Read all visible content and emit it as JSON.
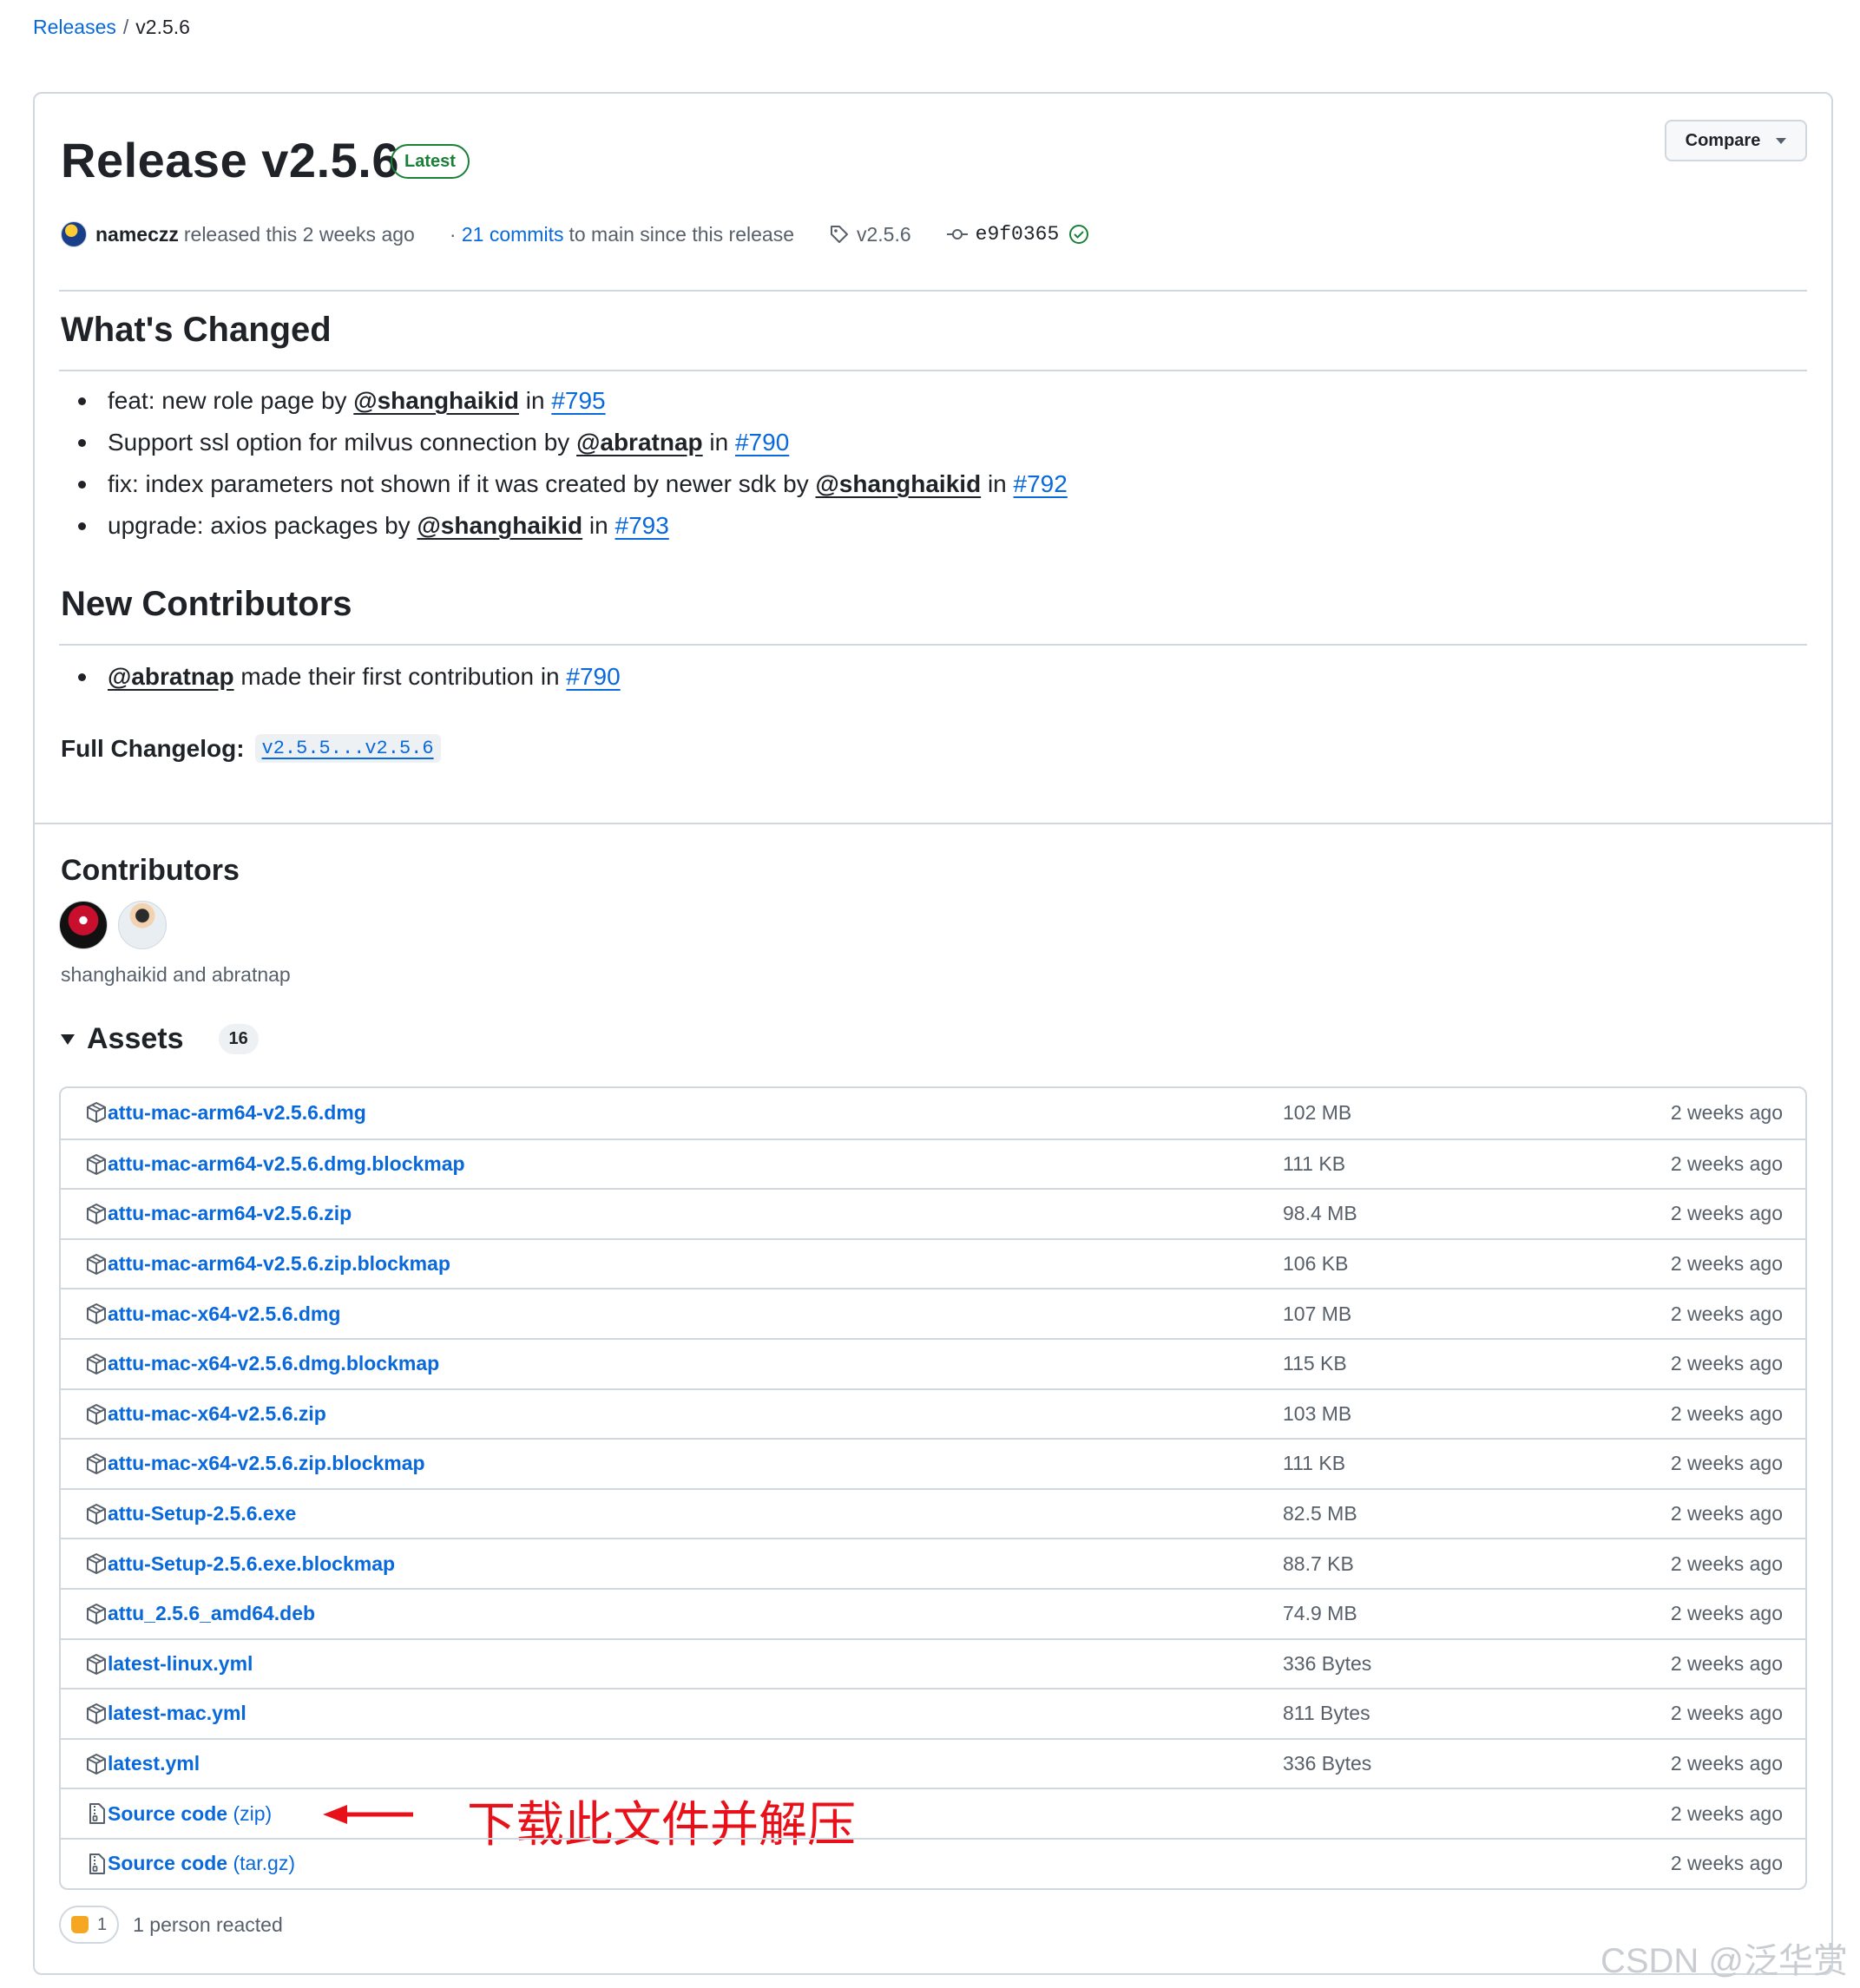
{
  "breadcrumb": {
    "releases": "Releases",
    "current": "v2.5.6"
  },
  "release": {
    "title": "Release v2.5.6",
    "badge": "Latest",
    "compare_label": "Compare",
    "author": "nameczz",
    "released_text": "released this 2 weeks ago",
    "commits_link": "21 commits",
    "commits_suffix": "to main since this release",
    "tag": "v2.5.6",
    "commit_sha": "e9f0365"
  },
  "whats_changed": {
    "title": "What's Changed",
    "items": [
      {
        "text": "feat: new role page by",
        "mention": "@shanghaikid",
        "in": "in",
        "issue": "#795"
      },
      {
        "text": "Support ssl option for milvus connection by",
        "mention": "@abratnap",
        "in": "in",
        "issue": "#790"
      },
      {
        "text": "fix: index parameters not shown if it was created by newer sdk by",
        "mention": "@shanghaikid",
        "in": "in",
        "issue": "#792"
      },
      {
        "text": "upgrade: axios packages by",
        "mention": "@shanghaikid",
        "in": "in",
        "issue": "#793"
      }
    ]
  },
  "new_contributors": {
    "title": "New Contributors",
    "items": [
      {
        "mention": "@abratnap",
        "text": "made their first contribution in",
        "issue": "#790"
      }
    ]
  },
  "changelog": {
    "label": "Full Changelog:",
    "range": "v2.5.5...v2.5.6"
  },
  "contributors": {
    "title": "Contributors",
    "names": "shanghaikid and abratnap"
  },
  "assets": {
    "title": "Assets",
    "count": "16",
    "rows": [
      {
        "name": "attu-mac-arm64-v2.5.6.dmg",
        "size": "102 MB",
        "date": "2 weeks ago",
        "icon": "package-icon"
      },
      {
        "name": "attu-mac-arm64-v2.5.6.dmg.blockmap",
        "size": "111 KB",
        "date": "2 weeks ago",
        "icon": "package-icon"
      },
      {
        "name": "attu-mac-arm64-v2.5.6.zip",
        "size": "98.4 MB",
        "date": "2 weeks ago",
        "icon": "package-icon"
      },
      {
        "name": "attu-mac-arm64-v2.5.6.zip.blockmap",
        "size": "106 KB",
        "date": "2 weeks ago",
        "icon": "package-icon"
      },
      {
        "name": "attu-mac-x64-v2.5.6.dmg",
        "size": "107 MB",
        "date": "2 weeks ago",
        "icon": "package-icon"
      },
      {
        "name": "attu-mac-x64-v2.5.6.dmg.blockmap",
        "size": "115 KB",
        "date": "2 weeks ago",
        "icon": "package-icon"
      },
      {
        "name": "attu-mac-x64-v2.5.6.zip",
        "size": "103 MB",
        "date": "2 weeks ago",
        "icon": "package-icon"
      },
      {
        "name": "attu-mac-x64-v2.5.6.zip.blockmap",
        "size": "111 KB",
        "date": "2 weeks ago",
        "icon": "package-icon"
      },
      {
        "name": "attu-Setup-2.5.6.exe",
        "size": "82.5 MB",
        "date": "2 weeks ago",
        "icon": "package-icon"
      },
      {
        "name": "attu-Setup-2.5.6.exe.blockmap",
        "size": "88.7 KB",
        "date": "2 weeks ago",
        "icon": "package-icon"
      },
      {
        "name": "attu_2.5.6_amd64.deb",
        "size": "74.9 MB",
        "date": "2 weeks ago",
        "icon": "package-icon"
      },
      {
        "name": "latest-linux.yml",
        "size": "336 Bytes",
        "date": "2 weeks ago",
        "icon": "package-icon"
      },
      {
        "name": "latest-mac.yml",
        "size": "811 Bytes",
        "date": "2 weeks ago",
        "icon": "package-icon"
      },
      {
        "name": "latest.yml",
        "size": "336 Bytes",
        "date": "2 weeks ago",
        "icon": "package-icon"
      }
    ],
    "source_zip": {
      "name": "Source code",
      "paren": "(zip)",
      "date": "2 weeks ago",
      "icon": "file-zip-icon"
    },
    "source_tar": {
      "name": "Source code",
      "paren": "(tar.gz)",
      "date": "2 weeks ago",
      "icon": "file-zip-icon"
    }
  },
  "annotation": {
    "text": "下载此文件并解压",
    "color": "#e8111a"
  },
  "reactions": {
    "count": "1",
    "text": "1 person reacted"
  },
  "watermark": "CSDN @泛华赏"
}
